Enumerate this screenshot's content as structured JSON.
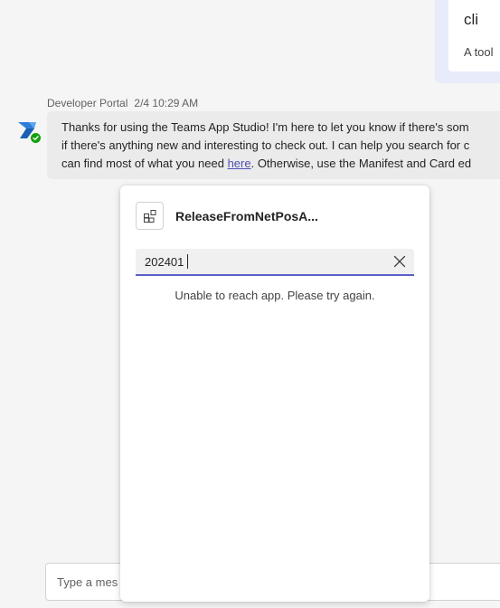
{
  "previous_card": {
    "title": "cli",
    "text": "A tool"
  },
  "message": {
    "sender": "Developer Portal",
    "timestamp": "2/4 10:29 AM",
    "line1": "Thanks for using the Teams App Studio! I'm here to let you know if there's som",
    "line2": "if there's anything new and interesting to check out. I can help you search for c",
    "line3_before": "can find most of what you need ",
    "line3_link": "here",
    "line3_after": ". Otherwise, use the Manifest and Card ed"
  },
  "popup": {
    "app_name": "ReleaseFromNetPosA...",
    "search_value": "202401",
    "error": "Unable to reach app. Please try again."
  },
  "compose": {
    "placeholder": "Type a mes"
  },
  "colors": {
    "accent": "#5b5fc7",
    "link": "#4f52b2",
    "presence": "#13a10e"
  },
  "icons": {
    "avatar": "developer-portal-logo",
    "presence": "available-check",
    "app": "app-grid-icon",
    "clear": "dismiss-x-icon"
  }
}
